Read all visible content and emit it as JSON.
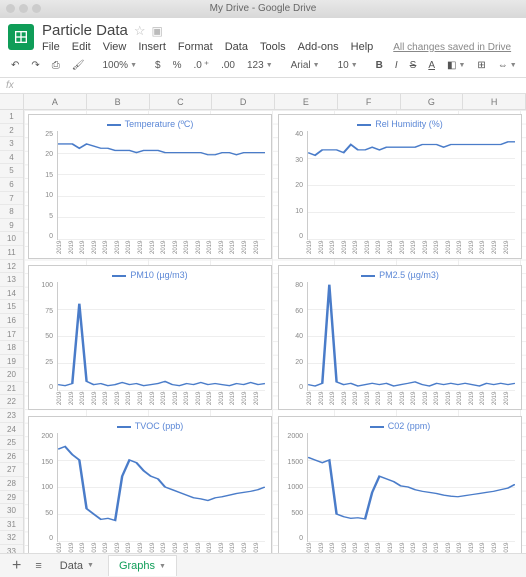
{
  "window": {
    "title": "My Drive - Google Drive"
  },
  "doc": {
    "title": "Particle Data",
    "save_status": "All changes saved in Drive"
  },
  "menu": [
    "File",
    "Edit",
    "View",
    "Insert",
    "Format",
    "Data",
    "Tools",
    "Add-ons",
    "Help"
  ],
  "toolbar": {
    "zoom": "100%",
    "money": "$",
    "percent": "%",
    "dec0": ".0",
    "dec00": ".00",
    "numfmt": "123",
    "font": "Arial",
    "size": "10",
    "bold": "B",
    "italic": "I",
    "strike": "S",
    "textcolor": "A"
  },
  "fx_label": "fx",
  "columns": [
    "A",
    "B",
    "C",
    "D",
    "E",
    "F",
    "G",
    "H"
  ],
  "row_count": 33,
  "sheets": {
    "data": "Data",
    "graphs": "Graphs",
    "add": "+"
  },
  "x_tick": "2019-0…",
  "x_tick_count": 18,
  "chart_data": [
    {
      "type": "line",
      "title": "Temperature (ºC)",
      "ylim": [
        0,
        25
      ],
      "yticks": [
        0,
        5,
        10,
        15,
        20,
        25
      ],
      "values": [
        22,
        22,
        22,
        21,
        22,
        21.5,
        21,
        21,
        20.5,
        20.5,
        20.5,
        20,
        20.5,
        20.5,
        20.5,
        20,
        20,
        20,
        20,
        20,
        20,
        19.5,
        19.5,
        20,
        20,
        19.5,
        20,
        20,
        20,
        20
      ]
    },
    {
      "type": "line",
      "title": "Rel Humidity (%)",
      "ylim": [
        0,
        40
      ],
      "yticks": [
        0,
        10,
        20,
        30,
        40
      ],
      "values": [
        32,
        31,
        33,
        33,
        33,
        32,
        35,
        33,
        33,
        34,
        33,
        34,
        34,
        34,
        34,
        34,
        35,
        35,
        35,
        34,
        35,
        35,
        35,
        35,
        35,
        35,
        35,
        35,
        36,
        36
      ]
    },
    {
      "type": "line",
      "title": "PM10 (µg/m3)",
      "ylim": [
        0,
        100
      ],
      "yticks": [
        0,
        25,
        50,
        75,
        100
      ],
      "values": [
        5,
        4,
        6,
        80,
        8,
        5,
        6,
        4,
        5,
        7,
        5,
        6,
        4,
        5,
        6,
        8,
        5,
        4,
        6,
        5,
        7,
        5,
        6,
        5,
        4,
        6,
        5,
        7,
        5,
        6
      ]
    },
    {
      "type": "line",
      "title": "PM2.5 (µg/m3)",
      "ylim": [
        0,
        80
      ],
      "yticks": [
        0,
        20,
        40,
        60,
        80
      ],
      "values": [
        4,
        3,
        5,
        78,
        6,
        4,
        5,
        3,
        4,
        5,
        4,
        5,
        3,
        4,
        5,
        6,
        4,
        3,
        5,
        4,
        5,
        4,
        5,
        4,
        3,
        5,
        4,
        5,
        4,
        5
      ]
    },
    {
      "type": "line",
      "title": "TVOC (ppb)",
      "ylim": [
        0,
        200
      ],
      "yticks": [
        0,
        50,
        100,
        150,
        200
      ],
      "values": [
        170,
        175,
        160,
        150,
        60,
        50,
        40,
        42,
        38,
        120,
        150,
        145,
        130,
        120,
        115,
        100,
        95,
        90,
        85,
        80,
        78,
        75,
        80,
        82,
        85,
        88,
        90,
        92,
        95,
        100
      ]
    },
    {
      "type": "line",
      "title": "C02 (ppm)",
      "ylim": [
        0,
        2000
      ],
      "yticks": [
        0,
        500,
        1000,
        1500,
        2000
      ],
      "values": [
        1550,
        1500,
        1450,
        1500,
        500,
        450,
        420,
        430,
        410,
        900,
        1200,
        1150,
        1100,
        1020,
        1000,
        950,
        920,
        900,
        880,
        850,
        830,
        820,
        840,
        860,
        880,
        900,
        920,
        950,
        980,
        1050
      ]
    }
  ]
}
